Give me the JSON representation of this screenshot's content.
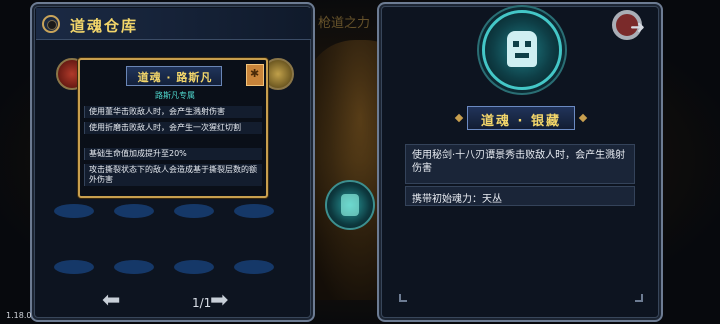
{
  "background": {
    "center_title": "枪道之力"
  },
  "left_panel": {
    "title": "道魂仓库",
    "pager": "1/1",
    "prev_icon": "arrow-left-icon",
    "next_icon": "arrow-right-icon"
  },
  "tooltip": {
    "title": "道魂 · 路斯凡",
    "subtitle": "路斯凡专属",
    "lines": [
      "使用董华击败敌人时，会产生溅射伤害",
      "使用折磨击败敌人时，会产生一次猩红切割",
      "基础生命值加成提升至20%",
      "攻击撕裂状态下的敌人会造成基于撕裂层数的额外伤害"
    ]
  },
  "right_panel": {
    "name": "道魂 · 银藏",
    "description": "使用秘剑·十八刃谭景秀击败敌人时，会产生溅射伤害",
    "carry": "携带初始魂力：天丛",
    "exit_icon": "exit-arrow-icon"
  },
  "version": "1.18.0"
}
